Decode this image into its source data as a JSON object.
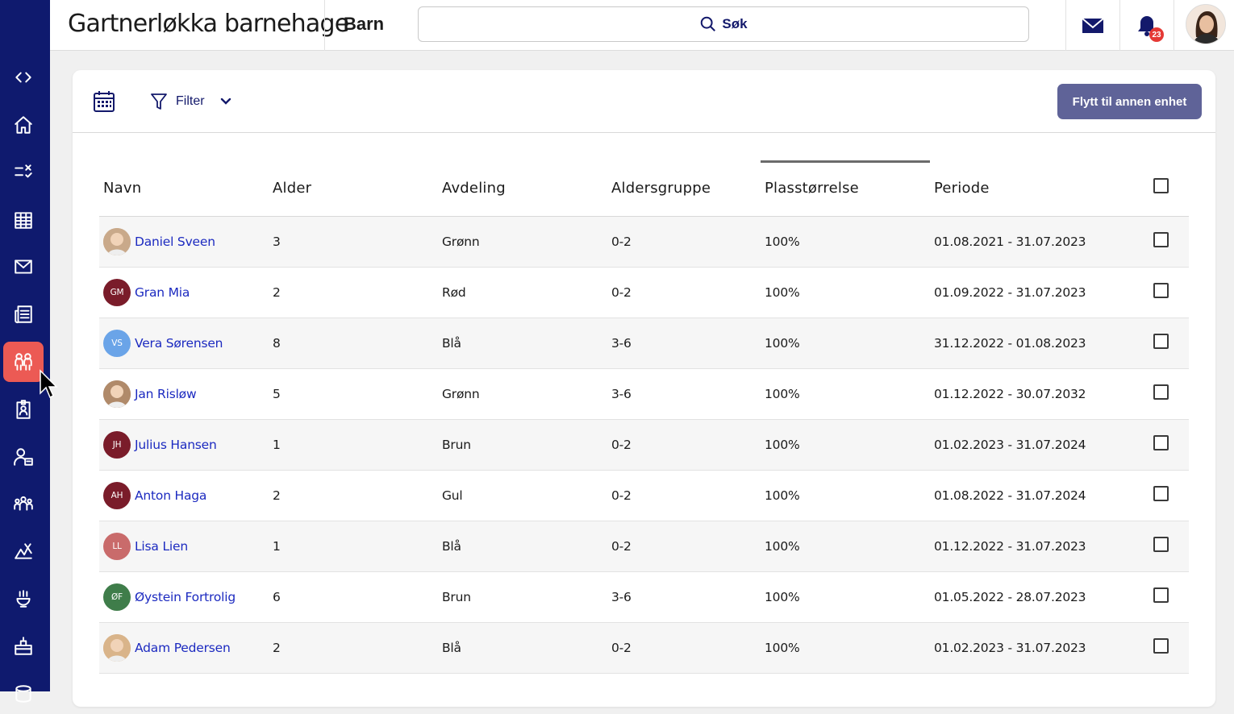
{
  "header": {
    "org_title": "Gartnerløkka barnehage",
    "page": "Barn",
    "search_label": "Søk",
    "notification_count": "23"
  },
  "sidebar": {
    "items": [
      {
        "icon": "code-toggle-icon"
      },
      {
        "icon": "home-icon"
      },
      {
        "icon": "tasks-icon"
      },
      {
        "icon": "calendar-grid-icon"
      },
      {
        "icon": "mail-icon"
      },
      {
        "icon": "news-icon"
      },
      {
        "icon": "children-icon",
        "active": true
      },
      {
        "icon": "badge-icon"
      },
      {
        "icon": "staff-icon"
      },
      {
        "icon": "groups-icon"
      },
      {
        "icon": "activities-icon"
      },
      {
        "icon": "food-icon"
      },
      {
        "icon": "building-icon"
      },
      {
        "icon": "database-icon"
      }
    ]
  },
  "toolbar": {
    "filter_label": "Filter",
    "move_button": "Flytt til annen enhet"
  },
  "table": {
    "columns": [
      "Navn",
      "Alder",
      "Avdeling",
      "Aldersgruppe",
      "Plasstørrelse",
      "Periode"
    ],
    "rows": [
      {
        "name": "Daniel Sveen",
        "initials": "",
        "avatar_color": "#c9a98a",
        "photo": true,
        "age": "3",
        "dept": "Grønn",
        "group": "0-2",
        "size": "100%",
        "period": "01.08.2021 - 31.07.2023"
      },
      {
        "name": "Gran Mia",
        "initials": "GM",
        "avatar_color": "#7a1c2a",
        "photo": false,
        "age": "2",
        "dept": "Rød",
        "group": "0-2",
        "size": "100%",
        "period": "01.09.2022 - 31.07.2023"
      },
      {
        "name": "Vera Sørensen",
        "initials": "VS",
        "avatar_color": "#6aa4e8",
        "photo": false,
        "age": "8",
        "dept": "Blå",
        "group": "3-6",
        "size": "100%",
        "period": "31.12.2022 - 01.08.2023"
      },
      {
        "name": "Jan Risløw",
        "initials": "",
        "avatar_color": "#b08a6a",
        "photo": true,
        "age": "5",
        "dept": "Grønn",
        "group": "3-6",
        "size": "100%",
        "period": "01.12.2022 - 30.07.2032"
      },
      {
        "name": "Julius Hansen",
        "initials": "JH",
        "avatar_color": "#7a1c2a",
        "photo": false,
        "age": "1",
        "dept": "Brun",
        "group": "0-2",
        "size": "100%",
        "period": "01.02.2023 - 31.07.2024"
      },
      {
        "name": "Anton Haga",
        "initials": "AH",
        "avatar_color": "#7a1c2a",
        "photo": false,
        "age": "2",
        "dept": "Gul",
        "group": "0-2",
        "size": "100%",
        "period": "01.08.2022 - 31.07.2024"
      },
      {
        "name": "Lisa Lien",
        "initials": "LL",
        "avatar_color": "#c96b6b",
        "photo": false,
        "age": "1",
        "dept": "Blå",
        "group": "0-2",
        "size": "100%",
        "period": "01.12.2022 - 31.07.2023"
      },
      {
        "name": "Øystein Fortrolig",
        "initials": "ØF",
        "avatar_color": "#3f7d4a",
        "photo": false,
        "age": "6",
        "dept": "Brun",
        "group": "3-6",
        "size": "100%",
        "period": "01.05.2022 - 28.07.2023"
      },
      {
        "name": "Adam Pedersen",
        "initials": "",
        "avatar_color": "#d9b48a",
        "photo": true,
        "age": "2",
        "dept": "Blå",
        "group": "0-2",
        "size": "100%",
        "period": "01.02.2023 - 31.07.2023"
      }
    ]
  }
}
